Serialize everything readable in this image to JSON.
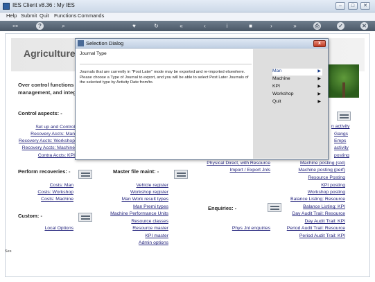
{
  "window": {
    "title": "IES Client v8.36 : My IES"
  },
  "menubar": {
    "items": [
      "Help",
      "Submit",
      "Quit",
      "Functions",
      "Commands"
    ]
  },
  "banner": {
    "title": "Agriculture P"
  },
  "blurb": {
    "line1": "Over control functions fo",
    "line2": "management, and integ"
  },
  "sections": {
    "control": "Control aspects: -",
    "perform": "Perform recoveries: -",
    "master": "Master file maint: -",
    "custom": "Custom: -",
    "enquiries": "Enquiries: -"
  },
  "control_links": [
    "Set up and Control",
    "Recovery Accts: Man",
    "Recovery Accts: Workshop",
    "Recovery Accts: Machine",
    "Contra Accts: KPI"
  ],
  "right_partial_links": [
    "n activity",
    "Gangs",
    "Emps",
    "activity",
    "posting"
  ],
  "perform_links": [
    "Costs: Man",
    "Costs: Workshop",
    "Costs: Machine"
  ],
  "master_links": [
    "Vehicle register",
    "Workshop register",
    "Man Work result types",
    "Man Premi types",
    "Machine Performance Units",
    "Resource classes",
    "Resource master",
    "KPI master",
    "Admin options"
  ],
  "mid_links": [
    "Physical Direct, with Resource",
    "Import / Export Jnls"
  ],
  "enquiry_links": [
    "Phys Jnl enquiries"
  ],
  "custom_links": [
    "Local Options"
  ],
  "posting_links": [
    "Machine posting (std)",
    "Machine posting (perf)",
    "Resource Posting",
    "KPI posting",
    "Workshop posting",
    "Balance Listing: Resource",
    "Balance Listing: KPI",
    "Day Audit Trail: Resource",
    "Day Audit Trail: KPI",
    "Period Audit Trail: Resource",
    "Period Audit Trail: KPI"
  ],
  "dialog": {
    "title": "Selection Dialog",
    "close_label": "x",
    "label": "Journal Type",
    "description": "Journals that are currently in \"Post Later\" mode may be exported and re-imported elsewhere. Please choose a Type of Journal to export, and you will be able to select Post Later Journals of the selected type by Activity Date from/to.",
    "options": [
      "Man",
      "Machine",
      "KPI",
      "Workshop",
      "Quit"
    ],
    "selected": "Man"
  },
  "sidebar_fragment": "Ses",
  "colors": {
    "link": "#1f1f7a",
    "toolbar": "#4a5766",
    "dialog_close": "#c03a22"
  }
}
